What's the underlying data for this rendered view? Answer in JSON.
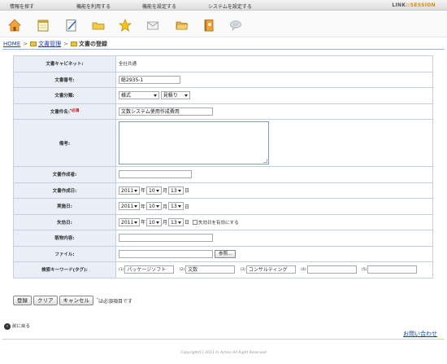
{
  "topmenu": {
    "items": [
      "情報を探す",
      "機能を利用する",
      "機能を設定する",
      "システムを設定する"
    ],
    "brand_part1": "LINK",
    "brand_part2": "::SESSION"
  },
  "toolbar_icons": [
    "home-icon",
    "calendar-icon",
    "note-icon",
    "folder-icon",
    "star-icon",
    "mail-icon",
    "open-folder-icon",
    "address-book-icon",
    "chat-icon"
  ],
  "breadcrumb": {
    "home": "HOME",
    "folder": "文書管理",
    "current": "文書の登録"
  },
  "form": {
    "cabinet": {
      "label": "文書キャビネット:",
      "value": "全社共通"
    },
    "doc_number": {
      "label": "文書番号:",
      "value": "総2935-1"
    },
    "category": {
      "label": "文書分類:",
      "select1": "様式",
      "select2": "見積り"
    },
    "doc_name": {
      "label": "文書件名:",
      "required_mark": "*必須",
      "value": "文数システム使用作成費用"
    },
    "remarks": {
      "label": "備考:"
    },
    "author": {
      "label": "文書作成者:"
    },
    "created_date": {
      "label": "文書作成日:",
      "year": "2011",
      "month": "10",
      "day": "13"
    },
    "effective_date": {
      "label": "実施日:",
      "year": "2011",
      "month": "10",
      "day": "13"
    },
    "expiry_date": {
      "label": "失効日:",
      "year": "2011",
      "month": "10",
      "day": "13",
      "checkbox_label": "失効日を有効にする"
    },
    "storage": {
      "label": "販物内容:"
    },
    "file": {
      "label": "ファイル:",
      "browse": "参照..."
    },
    "tags": {
      "label": "検索キーワード(タグ):",
      "items": [
        {
          "num": "(1)",
          "value": "パッケージソフト"
        },
        {
          "num": "(2)",
          "value": "文数"
        },
        {
          "num": "(3)",
          "value": "コンサルティング"
        },
        {
          "num": "(4)",
          "value": ""
        },
        {
          "num": "(5)",
          "value": ""
        }
      ]
    },
    "units": {
      "year": "年",
      "month": "月",
      "day": "日"
    }
  },
  "actions": {
    "register": "登録",
    "clear": "クリア",
    "cancel": "キャンセル",
    "note_mark": "*",
    "note": "は必須項目です"
  },
  "back_label": "前に戻る",
  "contact_label": "お問い合わせ",
  "copyright": "Copyright(C) 2011 In Action All Right Reserved"
}
